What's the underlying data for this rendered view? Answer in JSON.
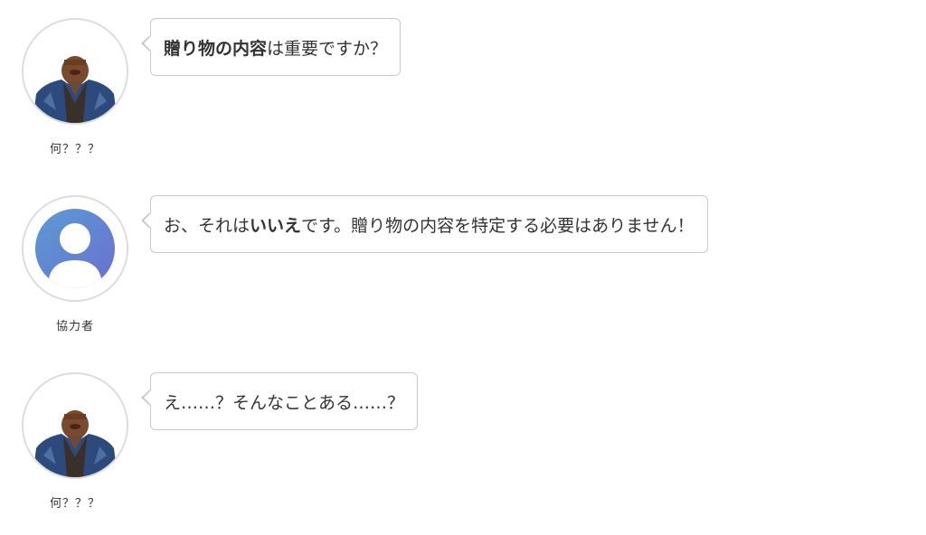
{
  "messages": [
    {
      "speaker": "何？？？",
      "avatar_icon": "person-photo-icon",
      "text": [
        {
          "t": "贈り物の内容",
          "bold": true
        },
        {
          "t": "は重要ですか？",
          "bold": false
        }
      ]
    },
    {
      "speaker": "協力者",
      "avatar_icon": "default-user-icon",
      "text": [
        {
          "t": "お、それは",
          "bold": false
        },
        {
          "t": "いいえ",
          "bold": true
        },
        {
          "t": "です。贈り物の内容を特定する必要はありません！",
          "bold": false
        }
      ]
    },
    {
      "speaker": "何？？？",
      "avatar_icon": "person-photo-icon",
      "text": [
        {
          "t": "え……？そんなことある……？",
          "bold": false
        }
      ]
    }
  ],
  "colors": {
    "bubble_border": "#c9c9c9",
    "avatar_border": "#dcdcdc",
    "default_avatar_gradient_start": "#5b9bd5",
    "default_avatar_gradient_end": "#6b6fcf",
    "text": "#333333"
  }
}
